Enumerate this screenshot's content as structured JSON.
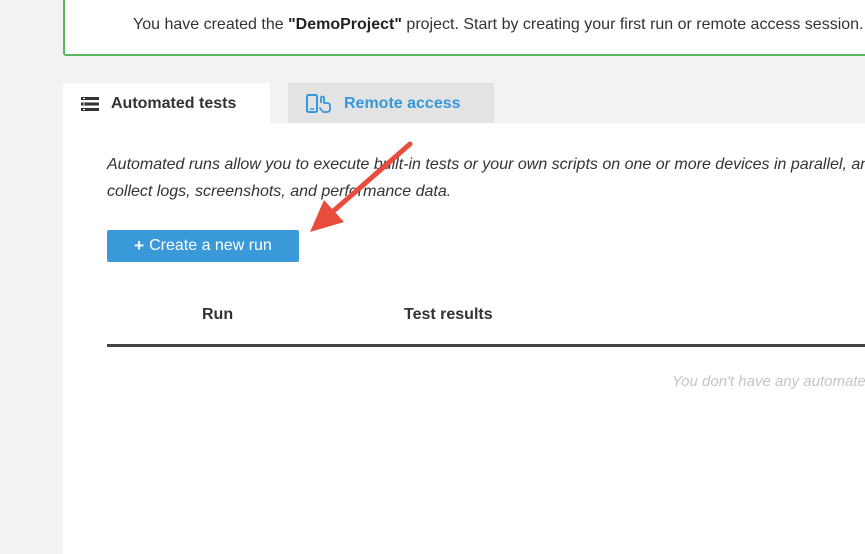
{
  "banner": {
    "text_before": "You have created the ",
    "project_name": "\"DemoProject\"",
    "text_after": " project. Start by creating your first run or remote access session."
  },
  "tabs": [
    {
      "label": "Automated tests",
      "icon": "list-icon",
      "active": true
    },
    {
      "label": "Remote access",
      "icon": "devices-touch-icon",
      "active": false
    }
  ],
  "automated": {
    "description": "Automated runs allow you to execute built-in tests or your own scripts on one or more devices in parallel, and to collect logs, screenshots, and performance data.",
    "create_button_label": "Create a new run",
    "create_button_icon": "+",
    "table": {
      "columns": [
        "Run",
        "Test results"
      ]
    },
    "empty_message": "You don't have any automated runs yet."
  },
  "colors": {
    "accent": "#3a9ad9",
    "success_border": "#5cb85c",
    "annotation_arrow": "#e74c3c"
  }
}
